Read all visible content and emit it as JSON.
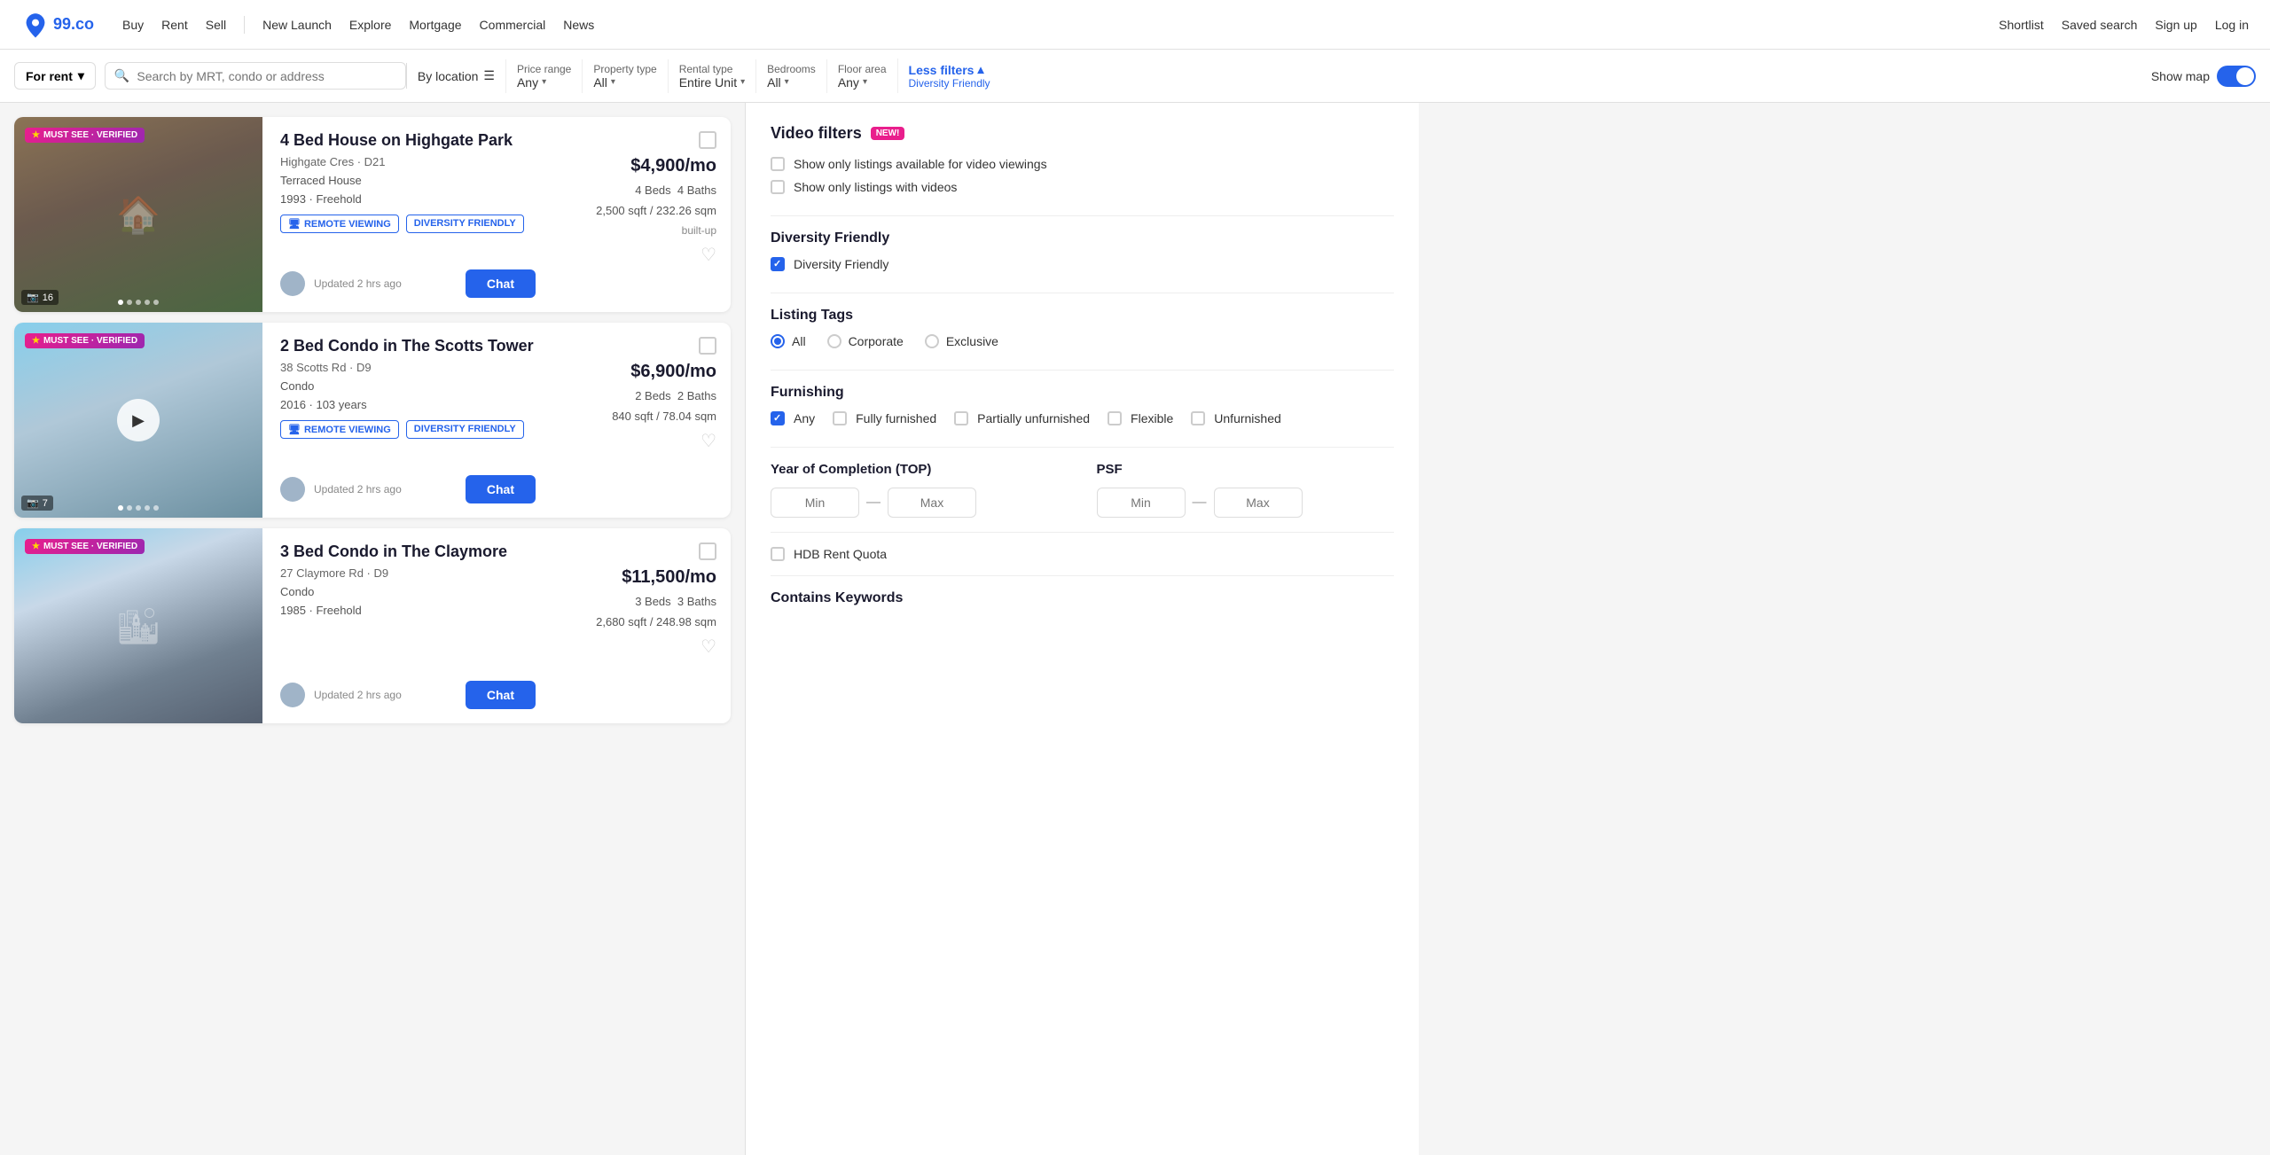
{
  "header": {
    "logo_text": "99.co",
    "nav": [
      "Buy",
      "Rent",
      "Sell",
      "New Launch",
      "Explore",
      "Mortgage",
      "Commercial",
      "News"
    ],
    "right_nav": [
      "Shortlist",
      "Saved search",
      "Sign up",
      "Log in"
    ]
  },
  "filter_bar": {
    "for_rent_label": "For rent",
    "search_placeholder": "Search by MRT, condo or address",
    "by_location_label": "By location",
    "filters": [
      {
        "label": "Price range",
        "value": "Any"
      },
      {
        "label": "Property type",
        "value": "All"
      },
      {
        "label": "Rental type",
        "value": "Entire Unit"
      },
      {
        "label": "Bedrooms",
        "value": "All"
      },
      {
        "label": "Floor area",
        "value": "Any"
      }
    ],
    "less_filters_label": "Less filters",
    "less_filters_sub": "Diversity Friendly",
    "show_map_label": "Show map"
  },
  "listings": [
    {
      "badge": "MUST SEE · VERIFIED",
      "title": "4 Bed House on Highgate Park",
      "address": "Highgate Cres · D21",
      "type": "Terraced House",
      "year_tenure": "1993 · Freehold",
      "price": "$4,900/mo",
      "beds": "4 Beds",
      "baths": "4 Baths",
      "sqft": "2,500 sqft / 232.26 sqm",
      "sqft_type": "built-up",
      "tags": [
        "REMOTE VIEWING",
        "DIVERSITY FRIENDLY"
      ],
      "photo_count": "16",
      "updated": "Updated 2 hrs ago",
      "has_video": false,
      "img_style": "img-bg-1"
    },
    {
      "badge": "MUST SEE · VERIFIED",
      "title": "2 Bed Condo in The Scotts Tower",
      "address": "38 Scotts Rd · D9",
      "type": "Condo",
      "year_tenure": "2016 · 103 years",
      "price": "$6,900/mo",
      "beds": "2 Beds",
      "baths": "2 Baths",
      "sqft": "840 sqft / 78.04 sqm",
      "sqft_type": "",
      "tags": [
        "REMOTE VIEWING",
        "DIVERSITY FRIENDLY"
      ],
      "photo_count": "7",
      "updated": "Updated 2 hrs ago",
      "has_video": true,
      "img_style": "img-bg-2"
    },
    {
      "badge": "MUST SEE · VERIFIED",
      "title": "3 Bed Condo in The Claymore",
      "address": "27 Claymore Rd · D9",
      "type": "Condo",
      "year_tenure": "1985 · Freehold",
      "price": "$11,500/mo",
      "beds": "3 Beds",
      "baths": "3 Baths",
      "sqft": "2,680 sqft / 248.98 sqm",
      "sqft_type": "",
      "tags": [],
      "photo_count": "",
      "updated": "Updated 2 hrs ago",
      "has_video": false,
      "img_style": "img-bg-3"
    }
  ],
  "right_panel": {
    "video_filters_title": "Video filters",
    "video_options": [
      "Show only listings available for video viewings",
      "Show only listings with videos"
    ],
    "diversity_title": "Diversity Friendly",
    "diversity_option": "Diversity Friendly",
    "diversity_checked": true,
    "listing_tags_title": "Listing Tags",
    "listing_tags": [
      "All",
      "Corporate",
      "Exclusive"
    ],
    "listing_tags_selected": "All",
    "furnishing_title": "Furnishing",
    "furnishing_options": [
      "Any",
      "Fully furnished",
      "Partially unfurnished",
      "Flexible",
      "Unfurnished"
    ],
    "furnishing_selected": [
      "Any"
    ],
    "top_title": "Year of Completion (TOP)",
    "top_min_placeholder": "Min",
    "top_max_placeholder": "Max",
    "psf_title": "PSF",
    "psf_min_placeholder": "Min",
    "psf_max_placeholder": "Max",
    "hdb_label": "HDB Rent Quota",
    "keywords_title": "Contains Keywords",
    "chat_label": "Chat"
  }
}
